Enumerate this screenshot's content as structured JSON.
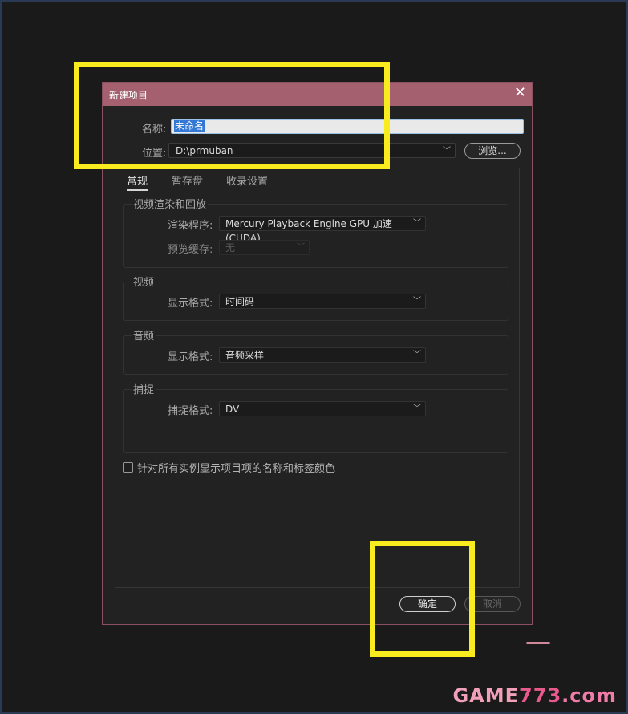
{
  "dialog": {
    "title": "新建项目",
    "name_label": "名称:",
    "name_value": "未命名",
    "location_label": "位置:",
    "location_value": "D:\\prmuban",
    "browse_label": "浏览...",
    "tabs": [
      {
        "label": "常规",
        "active": true
      },
      {
        "label": "暂存盘",
        "active": false
      },
      {
        "label": "收录设置",
        "active": false
      }
    ],
    "groups": {
      "video_render": {
        "title": "视频渲染和回放",
        "renderer_label": "渲染程序:",
        "renderer_value": "Mercury Playback Engine GPU 加速 (CUDA)",
        "preview_cache_label": "预览缓存:",
        "preview_cache_value": "无"
      },
      "video": {
        "title": "视频",
        "format_label": "显示格式:",
        "format_value": "时间码"
      },
      "audio": {
        "title": "音频",
        "format_label": "显示格式:",
        "format_value": "音频采样"
      },
      "capture": {
        "title": "捕捉",
        "format_label": "捕捉格式:",
        "format_value": "DV"
      }
    },
    "checkbox_label": "针对所有实例显示项目项的名称和标签颜色",
    "checkbox_checked": false,
    "ok_label": "确定",
    "cancel_label": "取消"
  },
  "icons": {
    "close": "close-icon",
    "chevron": "chevron-down-icon"
  },
  "colors": {
    "title_bar": "#a4606f",
    "highlight": "#f8eb1e",
    "selection": "#3378d4"
  },
  "watermark": {
    "prefix": "GAME",
    "number": "773",
    "suffix": ".com"
  }
}
